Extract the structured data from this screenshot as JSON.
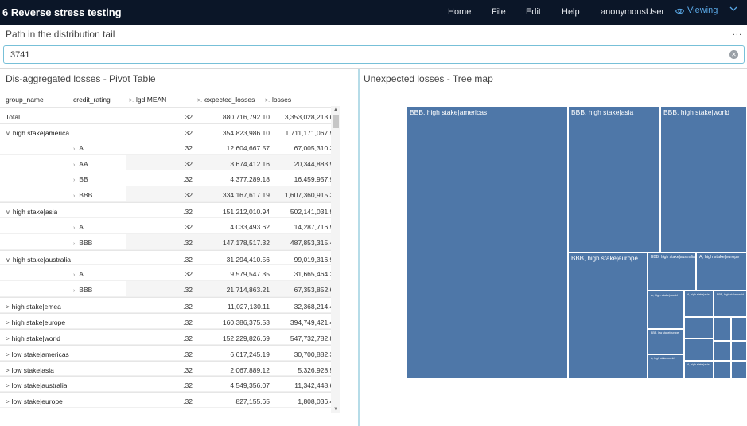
{
  "app": {
    "title": "6 Reverse stress testing",
    "nav": [
      "Home",
      "File",
      "Edit",
      "Help",
      "anonymousUser"
    ],
    "viewing_label": "Viewing"
  },
  "path": {
    "label": "Path in the distribution tail",
    "value": "3741",
    "more": "..."
  },
  "pivot": {
    "title": "Dis-aggregated losses - Pivot Table",
    "headers": [
      "group_name",
      "credit_rating",
      "lgd.MEAN",
      "expected_losses",
      "losses"
    ],
    "rows": [
      {
        "group": "Total",
        "rating": "",
        "lgd": ".32",
        "expected": "880,716,792.10",
        "losses": "3,353,028,213.68",
        "kind": "total"
      },
      {
        "group": "high stake|america",
        "rating": "",
        "lgd": ".32",
        "expected": "354,823,986.10",
        "losses": "1,711,171,067.56",
        "kind": "open"
      },
      {
        "group": "",
        "rating": "A",
        "lgd": ".32",
        "expected": "12,604,667.57",
        "losses": "67,005,310.31",
        "kind": "child"
      },
      {
        "group": "",
        "rating": "AA",
        "lgd": ".32",
        "expected": "3,674,412.16",
        "losses": "20,344,883.92",
        "kind": "child"
      },
      {
        "group": "",
        "rating": "BB",
        "lgd": ".32",
        "expected": "4,377,289.18",
        "losses": "16,459,957.98",
        "kind": "child"
      },
      {
        "group": "",
        "rating": "BBB",
        "lgd": ".32",
        "expected": "334,167,617.19",
        "losses": "1,607,360,915.34",
        "kind": "child"
      },
      {
        "group": "high stake|asia",
        "rating": "",
        "lgd": ".32",
        "expected": "151,212,010.94",
        "losses": "502,141,031.99",
        "kind": "open"
      },
      {
        "group": "",
        "rating": "A",
        "lgd": ".32",
        "expected": "4,033,493.62",
        "losses": "14,287,716.56",
        "kind": "child"
      },
      {
        "group": "",
        "rating": "BBB",
        "lgd": ".32",
        "expected": "147,178,517.32",
        "losses": "487,853,315.43",
        "kind": "child"
      },
      {
        "group": "high stake|australia",
        "rating": "",
        "lgd": ".32",
        "expected": "31,294,410.56",
        "losses": "99,019,316.92",
        "kind": "open"
      },
      {
        "group": "",
        "rating": "A",
        "lgd": ".32",
        "expected": "9,579,547.35",
        "losses": "31,665,464.27",
        "kind": "child"
      },
      {
        "group": "",
        "rating": "BBB",
        "lgd": ".32",
        "expected": "21,714,863.21",
        "losses": "67,353,852.64",
        "kind": "child"
      },
      {
        "group": "high stake|emea",
        "rating": "",
        "lgd": ".32",
        "expected": "11,027,130.11",
        "losses": "32,368,214.45",
        "kind": "closed"
      },
      {
        "group": "high stake|europe",
        "rating": "",
        "lgd": ".32",
        "expected": "160,386,375.53",
        "losses": "394,749,421.49",
        "kind": "closed"
      },
      {
        "group": "high stake|world",
        "rating": "",
        "lgd": ".32",
        "expected": "152,229,826.69",
        "losses": "547,732,782.85",
        "kind": "closed"
      },
      {
        "group": "low stake|americas",
        "rating": "",
        "lgd": ".32",
        "expected": "6,617,245.19",
        "losses": "30,700,882.34",
        "kind": "closed"
      },
      {
        "group": "low stake|asia",
        "rating": "",
        "lgd": ".32",
        "expected": "2,067,889.12",
        "losses": "5,326,928.58",
        "kind": "closed"
      },
      {
        "group": "low stake|australia",
        "rating": "",
        "lgd": ".32",
        "expected": "4,549,356.07",
        "losses": "11,342,448.60",
        "kind": "closed"
      },
      {
        "group": "low stake|europe",
        "rating": "",
        "lgd": ".32",
        "expected": "827,155.65",
        "losses": "1,808,036.48",
        "kind": "closed"
      }
    ]
  },
  "treemap": {
    "title": "Unexpected losses - Tree map",
    "color": "#4e77a8",
    "tiles": [
      "BBB, high stake|americas",
      "BBB, high stake|asia",
      "BBB, high stake|world",
      "BBB, high stake|europe",
      "BBB, high stake|australia",
      "A, high stake|europe",
      "A, high stake|world",
      "A, high stake|asia",
      "BBB, low stake|europe",
      "BBB, high stake|world",
      "A, high stake|world",
      "A, high stake|asia"
    ]
  }
}
